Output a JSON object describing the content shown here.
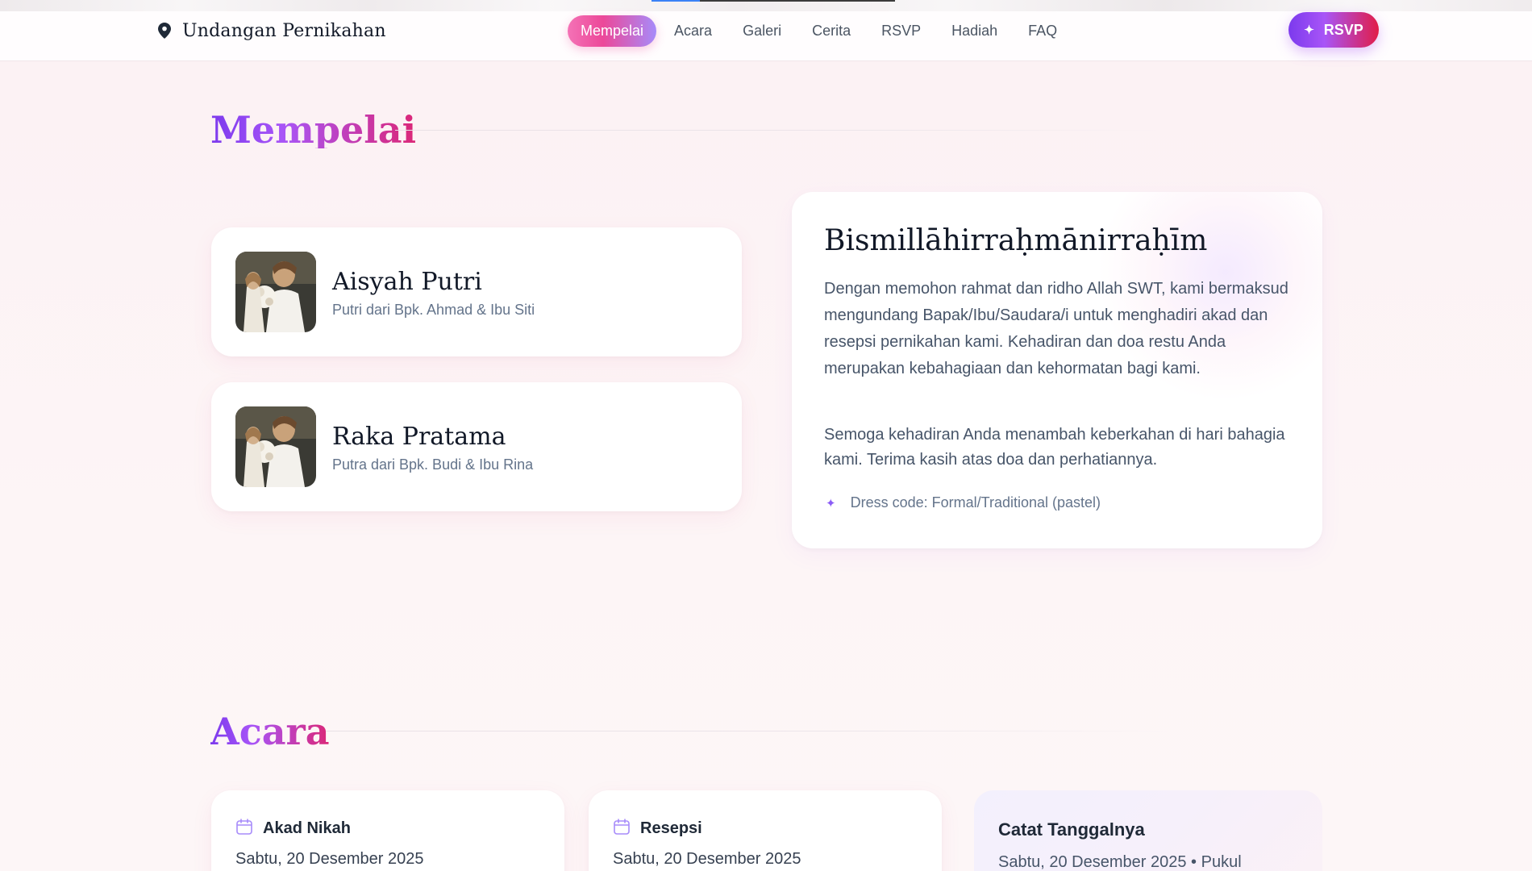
{
  "brand": {
    "title": "Undangan Pernikahan",
    "icon": "map-pin-icon"
  },
  "nav": {
    "items": [
      "Mempelai",
      "Acara",
      "Galeri",
      "Cerita",
      "RSVP",
      "Hadiah",
      "FAQ"
    ],
    "active": "Mempelai",
    "scroll_progress": 0.2
  },
  "cta": {
    "label": "RSVP",
    "icon": "sparkle-icon"
  },
  "couple_section": {
    "title": "Mempelai",
    "bride": {
      "name": "Aisyah Putri",
      "parents": "Putri dari Bpk. Ahmad & Ibu Siti"
    },
    "groom": {
      "name": "Raka Pratama",
      "parents": "Putra dari Bpk. Budi & Ibu Rina"
    }
  },
  "invitation": {
    "heading": "Bismillāhirraḥmānirraḥīm",
    "paragraph1": "Dengan memohon rahmat dan ridho Allah SWT, kami bermaksud mengundang Bapak/Ibu/Saudara/i untuk menghadiri akad dan resepsi pernikahan kami. Kehadiran dan doa restu Anda merupakan kebahagiaan dan kehormatan bagi kami.",
    "paragraph2": "Semoga kehadiran Anda menambah keberkahan di hari bahagia kami. Terima kasih atas doa dan perhatiannya.",
    "dress_code": "Dress code: Formal/Traditional (pastel)"
  },
  "events_section": {
    "title": "Acara",
    "events": [
      {
        "title": "Akad Nikah",
        "date": "Sabtu, 20 Desember 2025",
        "icon": "calendar-icon"
      },
      {
        "title": "Resepsi",
        "date": "Sabtu, 20 Desember 2025",
        "icon": "calendar-icon"
      }
    ],
    "save_the_date": {
      "title": "Catat Tanggalnya",
      "text": "Sabtu, 20 Desember 2025 • Pukul"
    }
  },
  "colors": {
    "accent_purple": "#7c3aed",
    "accent_pink": "#db2777",
    "background": "#fdf3f5",
    "text_dark": "#111827",
    "text_muted": "#64748b"
  }
}
